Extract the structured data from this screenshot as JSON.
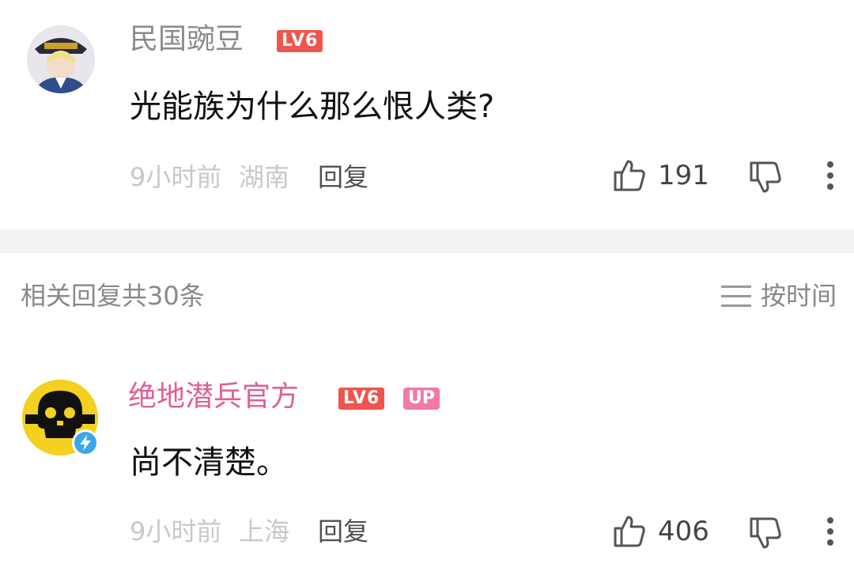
{
  "comments": [
    {
      "username": "民国豌豆",
      "level": "LV6",
      "text": "光能族为什么那么恨人类?",
      "time": "9小时前",
      "location": "湖南",
      "reply_label": "回复",
      "likes": "191"
    },
    {
      "username": "绝地潜兵官方",
      "level": "LV6",
      "up_badge": "UP",
      "text": "尚不清楚。",
      "time": "9小时前",
      "location": "上海",
      "reply_label": "回复",
      "likes": "406"
    }
  ],
  "replies_section": {
    "title": "相关回复共30条",
    "sort_label": "按时间"
  },
  "colors": {
    "level_badge": "#f0544f",
    "up_badge": "#f07aa8",
    "official_name": "#e05f97",
    "username": "#8a8a8a",
    "divider": "#f5f2f3"
  },
  "icons": [
    "like-icon",
    "dislike-icon",
    "more-icon",
    "sort-lines-icon",
    "verified-bolt-icon"
  ]
}
